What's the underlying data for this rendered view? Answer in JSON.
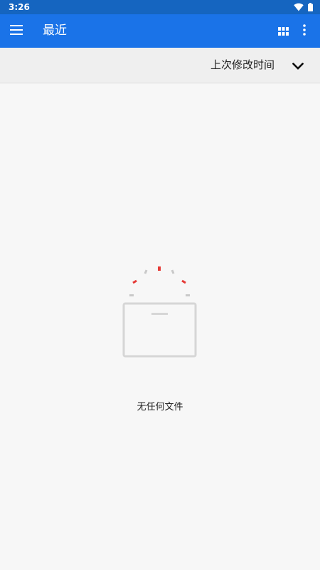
{
  "status_bar": {
    "time": "3:26",
    "wifi_icon": "wifi-icon",
    "battery_icon": "battery-icon"
  },
  "app_bar": {
    "title": "最近",
    "menu_icon": "hamburger-menu-icon",
    "grid_icon": "grid-view-icon",
    "more_icon": "more-vertical-icon",
    "color": "#1a73e8"
  },
  "sort_bar": {
    "label": "上次修改时间",
    "dropdown_icon": "chevron-down-icon"
  },
  "empty_state": {
    "message": "无任何文件",
    "illustration": "empty-folder-icon"
  },
  "colors": {
    "status_bar": "#1565c0",
    "app_bar": "#1a73e8",
    "background": "#f7f7f7",
    "sort_bar": "#efefef",
    "accent_red": "#e53935"
  }
}
